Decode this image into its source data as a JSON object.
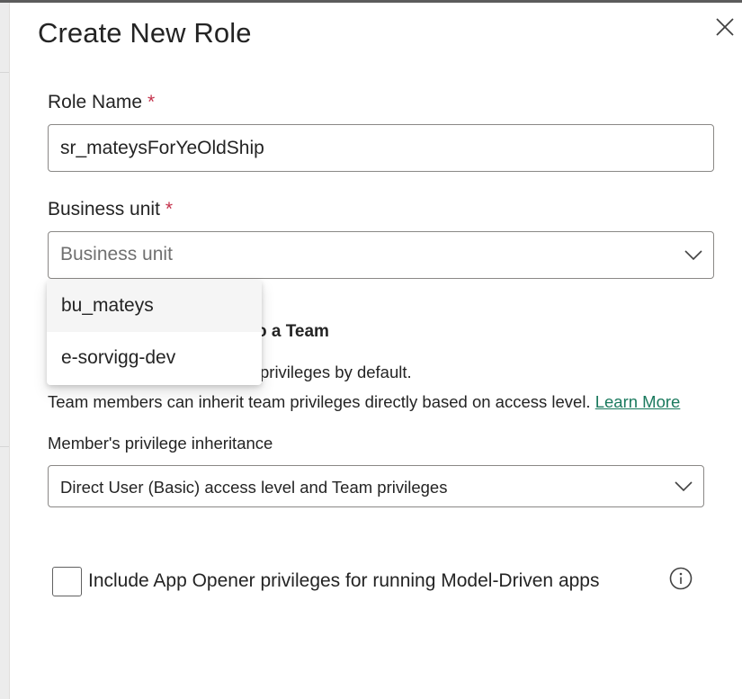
{
  "dialog": {
    "title": "Create New Role"
  },
  "role_name": {
    "label": "Role Name",
    "required_mark": "*",
    "value": "sr_mateysForYeOldShip"
  },
  "business_unit": {
    "label": "Business unit",
    "required_mark": "*",
    "placeholder": "Business unit",
    "options": [
      "bu_mateys",
      "e-sorvigg-dev"
    ]
  },
  "team_section": {
    "heading_visible": "o a Team",
    "desc_line1_visible": "privileges by default.",
    "desc_line2": "Team members can inherit team privileges directly based on access level.",
    "learn_more": "Learn More"
  },
  "inheritance": {
    "label": "Member's privilege inheritance",
    "selected": "Direct User (Basic) access level and Team privileges"
  },
  "app_opener": {
    "label": "Include App Opener privileges for running Model-Driven apps",
    "checked": false
  },
  "colors": {
    "link": "#1b7a5e",
    "required": "#c4314b",
    "border": "#8a8886"
  },
  "icons": {
    "close": "close-icon",
    "dropdown": "chevron-down-icon",
    "info": "info-icon"
  }
}
